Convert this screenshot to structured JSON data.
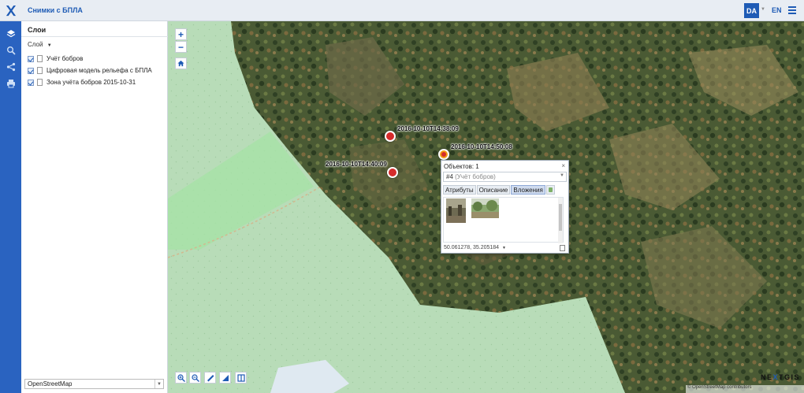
{
  "app": {
    "title": "Снимки с БПЛА",
    "lang_active": "DA",
    "lang_other": "EN"
  },
  "toolbar": {
    "icons": [
      "layers-icon",
      "search-icon",
      "share-icon",
      "print-icon"
    ]
  },
  "layers_panel": {
    "title": "Слои",
    "menu_label": "Слой",
    "items": [
      {
        "label": "Учёт бобров",
        "checked": true
      },
      {
        "label": "Цифровая модель рельефа с БПЛА",
        "checked": true
      },
      {
        "label": "Зона учёта бобров 2015-10-31",
        "checked": true
      }
    ],
    "basemap": "OpenStreetMap"
  },
  "map": {
    "markers": [
      {
        "label": "2016-10-10T14:38:09"
      },
      {
        "label": "2016-10-10T14:50:08"
      },
      {
        "label": "2016-10-10T14:40:09"
      }
    ],
    "zoom_in": "+",
    "zoom_out": "−",
    "brand": {
      "pre": "NE",
      "x": "X",
      "post": "TGIS"
    },
    "attribution": "© OpenStreetMap contributors"
  },
  "popup": {
    "header": "Объектов: 1",
    "close": "×",
    "object_id": "#4",
    "object_layer": "(Учёт бобров)",
    "tabs": [
      "Атрибуты",
      "Описание",
      "Вложения"
    ],
    "active_tab": "Вложения",
    "coordinates": "50.061278, 35.205184"
  },
  "colors": {
    "accent": "#1e5bb5",
    "toolbar": "#2a63c0",
    "marker": "#d52b2b",
    "marker_selected": "#f39c12",
    "forest_bg": "#b8dcb8"
  }
}
